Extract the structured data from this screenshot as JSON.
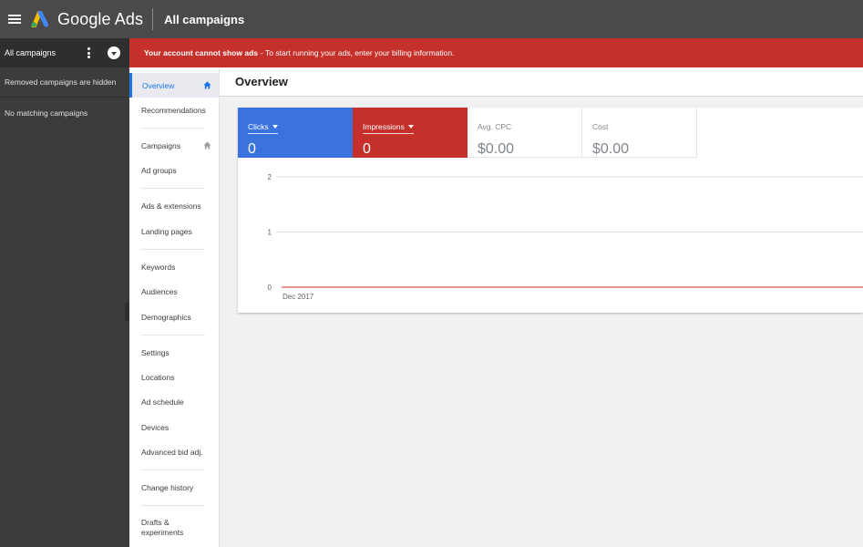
{
  "header": {
    "brand": "Google Ads",
    "page_title": "All campaigns"
  },
  "left_panel": {
    "title": "All campaigns",
    "rows": [
      "Removed campaigns are hidden",
      "No matching campaigns"
    ]
  },
  "alert": {
    "bold": "Your account cannot show ads",
    "text": "- To start running your ads, enter your billing information."
  },
  "nav": {
    "items": [
      "Overview",
      "Recommendations",
      "Campaigns",
      "Ad groups",
      "Ads & extensions",
      "Landing pages",
      "Keywords",
      "Audiences",
      "Demographics",
      "Settings",
      "Locations",
      "Ad schedule",
      "Devices",
      "Advanced bid adj.",
      "Change history"
    ],
    "drafts_line1": "Drafts &",
    "drafts_line2": "experiments"
  },
  "overview": {
    "title": "Overview",
    "metrics": [
      {
        "label": "Clicks",
        "value": "0",
        "color": "#3a73de"
      },
      {
        "label": "Impressions",
        "value": "0",
        "color": "#c5302b"
      },
      {
        "label": "Avg. CPC",
        "value": "$0.00"
      },
      {
        "label": "Cost",
        "value": "$0.00"
      }
    ]
  },
  "chart_data": {
    "type": "line",
    "yticks": [
      "2",
      "1",
      "0"
    ],
    "x": [
      "Dec 2017"
    ],
    "xlabel_text": "Dec 2017",
    "ylim": [
      0,
      2
    ],
    "series": [
      {
        "values": [
          0
        ],
        "color": "#c5302b"
      }
    ],
    "grid": true
  },
  "icons": {
    "menu": "hamburger-icon",
    "logo": "google-ads-logo",
    "more": "more-vert-icon",
    "dropdown": "dropdown-circle-icon",
    "home": "home-icon",
    "collapse": "chevron-left-icon"
  }
}
